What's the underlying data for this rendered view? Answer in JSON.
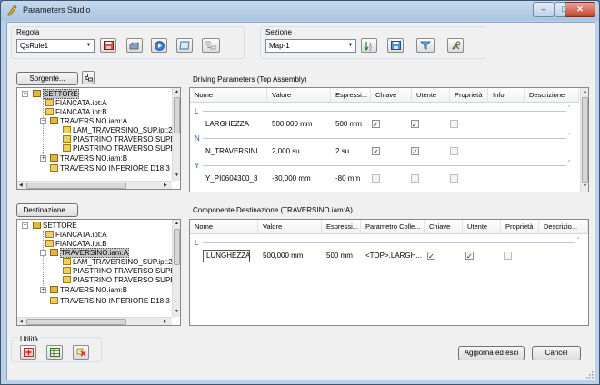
{
  "window": {
    "title": "Parameters Studio",
    "minimize": "–",
    "maximize": "□",
    "close": "✕"
  },
  "regola": {
    "label": "Regola",
    "value": "QsRule1"
  },
  "sezione": {
    "label": "Sezione",
    "value": "Map-1"
  },
  "sorgente_button": "Sorgente...",
  "destinazione_button": "Destinazione...",
  "driving": {
    "title": "Driving Parameters (Top Assembly)",
    "columns": [
      "Nome",
      "Valore",
      "Espressi...",
      "Chiave",
      "Utente",
      "Proprietà",
      "Info",
      "Descrizione"
    ],
    "groups": [
      {
        "letter": "L",
        "rows": [
          {
            "nome": "LARGHEZZA",
            "valore": "500,000 mm",
            "espressione": "500 mm",
            "chiave": true,
            "utente": true,
            "proprieta": false
          }
        ]
      },
      {
        "letter": "N",
        "rows": [
          {
            "nome": "N_TRAVERSINI",
            "valore": "2,000 su",
            "espressione": "2 su",
            "chiave": true,
            "utente": true,
            "proprieta": false
          }
        ]
      },
      {
        "letter": "Y",
        "rows": [
          {
            "nome": "Y_PI0604300_3",
            "valore": "-80,000 mm",
            "espressione": "-80 mm",
            "chiave": false,
            "utente": false,
            "proprieta": false
          }
        ]
      }
    ]
  },
  "componente": {
    "title": "Componente Destinazione (TRAVERSINO.iam:A)",
    "columns": [
      "Nome",
      "Valore",
      "Espressi...",
      "Parametro Colle...",
      "Chiave",
      "Utente",
      "Proprietà",
      "Descrizio..."
    ],
    "groups": [
      {
        "letter": "L",
        "rows": [
          {
            "nome": "LUNGHEZZA",
            "valore": "500,000 mm",
            "espressione": "500 mm",
            "parametro": "<TOP>.LARGH...",
            "chiave": true,
            "utente": true,
            "proprieta": false
          }
        ]
      }
    ]
  },
  "source_tree": [
    "SETTORE",
    "FIANCATA.ipt:A",
    "FIANCATA.ipt:B",
    "TRAVERSINO.iam:A",
    "LAM_TRAVERSINO_SUP.ipt:2",
    "PIASTRINO TRAVERSO SUPER",
    "PIASTRINO TRAVERSO SUPER",
    "TRAVERSINO.iam:B",
    "TRAVERSINO INFERIORE D18:3"
  ],
  "dest_tree": [
    "SETTORE",
    "FIANCATA.ipt:A",
    "FIANCATA.ipt:B",
    "TRAVERSINO.iam:A",
    "LAM_TRAVERSINO_SUP.ipt:2",
    "PIASTRINO TRAVERSO SUPER",
    "PIASTRINO TRAVERSO SUPER",
    "TRAVERSINO.iam:B",
    "TRAVERSINO INFERIORE D18:3"
  ],
  "utilita": {
    "label": "Utilità"
  },
  "buttons": {
    "aggiorna": "Aggiorna ed esci",
    "cancel": "Cancel"
  },
  "icons": {
    "regola_tools": [
      "save-red-icon",
      "factory-icon",
      "play-icon",
      "sheet-icon",
      "tree-disabled-icon"
    ],
    "sezione_tools": [
      "sort-icon",
      "save-blue-icon",
      "filter-icon",
      "tools-icon"
    ]
  }
}
